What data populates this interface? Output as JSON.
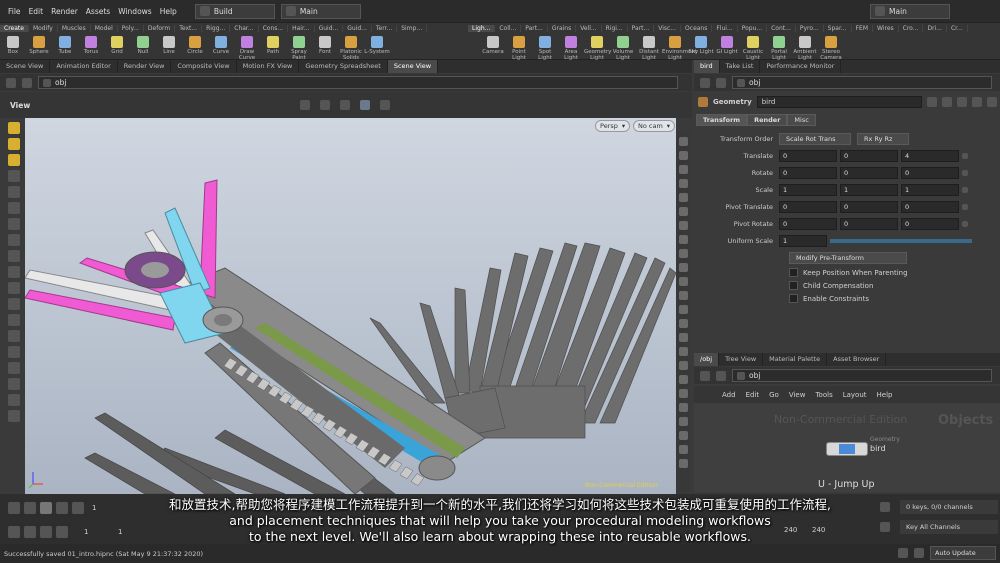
{
  "menubar": {
    "items": [
      "File",
      "Edit",
      "Render",
      "Assets",
      "Windows",
      "Help"
    ],
    "desktop": "Build",
    "context": "Main",
    "right_context": "Main"
  },
  "shelf": {
    "left_tabs": [
      "Create",
      "Modify",
      "Muscles",
      "Model",
      "Poly...",
      "Deform",
      "Text...",
      "Rigg...",
      "Char...",
      "Cons...",
      "Hair...",
      "Guid...",
      "Guid...",
      "Terr...",
      "Simp..."
    ],
    "left_tools": [
      "Box",
      "Sphere",
      "Tube",
      "Torus",
      "Grid",
      "Null",
      "Line",
      "Circle",
      "Curve",
      "Draw Curve",
      "Path",
      "Spray Paint",
      "Font",
      "Platonic Solids",
      "L-System"
    ],
    "right_tabs": [
      "Ligh...",
      "Coll...",
      "Part...",
      "Grains",
      "Vell...",
      "Rigi...",
      "Part...",
      "Visc...",
      "Oceans",
      "Flui...",
      "Popu...",
      "Cont...",
      "Pyro...",
      "Spar...",
      "FEM",
      "Wires",
      "Cro...",
      "Dri...",
      "Cr..."
    ],
    "right_tools": [
      "Camera",
      "Point Light",
      "Spot Light",
      "Area Light",
      "Geometry Light",
      "Volume Light",
      "Distant Light",
      "Environment Light",
      "Sky Light",
      "GI Light",
      "Caustic Light",
      "Portal Light",
      "Ambient Light",
      "Stereo Camera"
    ]
  },
  "left_panel": {
    "tabs": [
      "Scene View",
      "Animation Editor",
      "Render View",
      "Composite View",
      "Motion FX View",
      "Geometry Spreadsheet",
      "Scene View"
    ],
    "path": "obj",
    "view_label": "View",
    "persp": "Persp",
    "cam": "No cam",
    "watermark": "Non-Commercial Edition"
  },
  "right_panel": {
    "tabs": [
      "bird",
      "Take List",
      "Performance Monitor"
    ],
    "path": "obj",
    "node_type": "Geometry",
    "node_name": "bird",
    "param_tabs": [
      "Transform",
      "Render",
      "Misc"
    ],
    "transform_order_label": "Transform Order",
    "transform_order": "Scale Rot Trans",
    "rot_order": "Rx Ry Rz",
    "params": [
      {
        "label": "Translate",
        "v": [
          "0",
          "0",
          "4"
        ]
      },
      {
        "label": "Rotate",
        "v": [
          "0",
          "0",
          "0"
        ]
      },
      {
        "label": "Scale",
        "v": [
          "1",
          "1",
          "1"
        ]
      },
      {
        "label": "Pivot Translate",
        "v": [
          "0",
          "0",
          "0"
        ]
      },
      {
        "label": "Pivot Rotate",
        "v": [
          "0",
          "0",
          "0"
        ]
      }
    ],
    "uniform_scale_label": "Uniform Scale",
    "uniform_scale": "1",
    "modify_pre": "Modify Pre-Transform",
    "checks": [
      "Keep Position When Parenting",
      "Child Compensation",
      "Enable Constraints"
    ]
  },
  "network": {
    "tabs": [
      "/obj",
      "Tree View",
      "Material Palette",
      "Asset Browser"
    ],
    "path": "obj",
    "menu": [
      "Add",
      "Edit",
      "Go",
      "View",
      "Tools",
      "Layout",
      "Help"
    ],
    "watermark": "Non-Commercial Edition",
    "context_label": "Objects",
    "node_type": "Geometry",
    "node_name": "bird",
    "jump": "U - Jump Up"
  },
  "timeline": {
    "frame": "1",
    "start": "1",
    "start2": "1",
    "end": "240",
    "end2": "240",
    "keys": "0 keys, 0/0 channels",
    "key_all": "Key All Channels",
    "auto_update": "Auto Update"
  },
  "status": "Successfully saved 01_intro.hipnc (Sat May  9 21:37:32 2020)",
  "subtitle": {
    "zh": "和放置技术,帮助您将程序建模工作流程提升到一个新的水平,我们还将学习如何将这些技术包装成可重复使用的工作流程,",
    "en1": "and placement techniques that will help you take your procedural modeling workflows",
    "en2": "to the next level. We'll also learn about wrapping these into reusable workflows."
  },
  "colors": {
    "pink": "#f05ad2",
    "cyan": "#7fd6ee",
    "blue": "#3aa3d8",
    "gray_model": "#6e6e6e"
  }
}
